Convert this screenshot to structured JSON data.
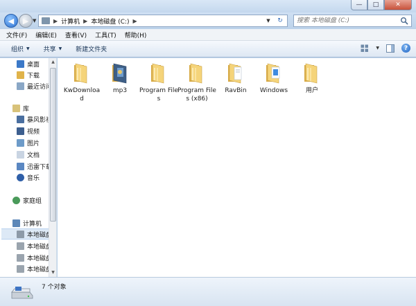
{
  "window": {
    "minimize": "—",
    "maximize": "□",
    "close": "✕"
  },
  "address": {
    "crumbs": [
      "计算机",
      "本地磁盘 (C:)"
    ],
    "search_placeholder": "搜索 本地磁盘 (C:)"
  },
  "menu": [
    "文件(F)",
    "编辑(E)",
    "查看(V)",
    "工具(T)",
    "帮助(H)"
  ],
  "toolbar": {
    "organize": "组织",
    "share": "共享",
    "new_folder": "新建文件夹",
    "help": "?"
  },
  "nav": {
    "favorites": [
      "桌面",
      "下载",
      "最近访问的位置"
    ],
    "libraries_title": "库",
    "libraries": [
      "暴风影视库",
      "视频",
      "图片",
      "文档",
      "迅雷下载",
      "音乐"
    ],
    "homegroup": "家庭组",
    "computer_title": "计算机",
    "drives": [
      "本地磁盘 (C:)",
      "本地磁盘 (D:)",
      "本地磁盘 (E:)",
      "本地磁盘 (F:)"
    ]
  },
  "files": [
    {
      "name": "KwDownload",
      "icon": "folder-icon"
    },
    {
      "name": "mp3",
      "icon": "folder-media-icon"
    },
    {
      "name": "Program Files",
      "icon": "folder-icon"
    },
    {
      "name": "Program Files (x86)",
      "icon": "folder-icon"
    },
    {
      "name": "RavBin",
      "icon": "folder-doc-icon"
    },
    {
      "name": "Windows",
      "icon": "folder-windows-icon"
    },
    {
      "name": "用户",
      "icon": "folder-icon"
    }
  ],
  "status": {
    "count": "7 个对象"
  },
  "colors": {
    "folder": "#e9c56b",
    "accent": "#2a6fd0",
    "selection": "#dde9f6"
  }
}
